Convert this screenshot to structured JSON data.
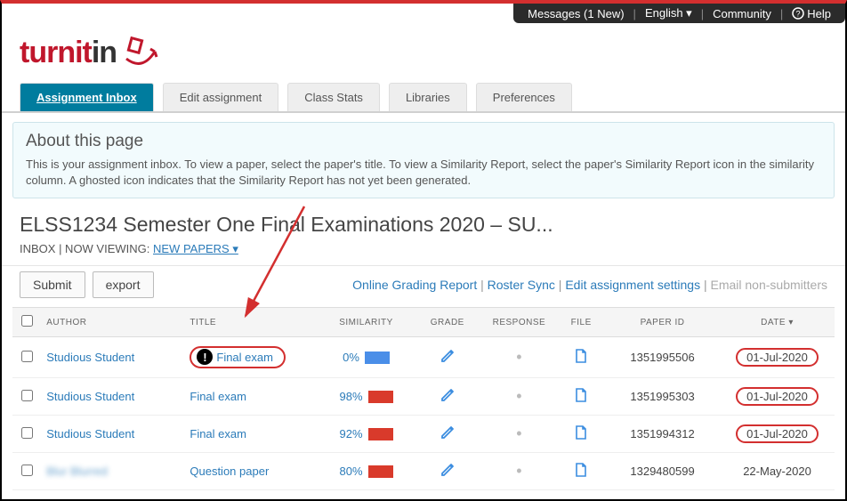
{
  "top": {
    "messages": "Messages (1 New)",
    "language": "English ▾",
    "community": "Community",
    "help": "Help"
  },
  "logo": {
    "part1": "turnit",
    "part2": "in"
  },
  "tabs": [
    {
      "label": "Assignment Inbox",
      "active": true
    },
    {
      "label": "Edit assignment",
      "active": false
    },
    {
      "label": "Class Stats",
      "active": false
    },
    {
      "label": "Libraries",
      "active": false
    },
    {
      "label": "Preferences",
      "active": false
    }
  ],
  "info": {
    "title": "About this page",
    "body": "This is your assignment inbox. To view a paper, select the paper's title. To view a Similarity Report, select the paper's Similarity Report icon in the similarity column. A ghosted icon indicates that the Similarity Report has not yet been generated."
  },
  "heading": "ELSS1234 Semester One Final Examinations 2020 – SU...",
  "viewing_prefix": "INBOX | NOW VIEWING: ",
  "viewing_link": "NEW PAPERS ▾",
  "buttons": {
    "submit": "Submit",
    "export": "export"
  },
  "links": {
    "ogr": "Online Grading Report",
    "roster": "Roster Sync",
    "edit": "Edit assignment settings",
    "email": "Email non-submitters"
  },
  "cols": {
    "author": "AUTHOR",
    "title": "TITLE",
    "similarity": "SIMILARITY",
    "grade": "GRADE",
    "response": "RESPONSE",
    "file": "FILE",
    "paperid": "PAPER ID",
    "date": "DATE"
  },
  "rows": [
    {
      "author": "Studious Student",
      "title": "Final exam",
      "alert": true,
      "circleTitle": true,
      "sim": "0%",
      "simcolor": "blue",
      "paperid": "1351995506",
      "date": "01-Jul-2020",
      "circleDate": true
    },
    {
      "author": "Studious Student",
      "title": "Final exam",
      "alert": false,
      "circleTitle": false,
      "sim": "98%",
      "simcolor": "red",
      "paperid": "1351995303",
      "date": "01-Jul-2020",
      "circleDate": true
    },
    {
      "author": "Studious Student",
      "title": "Final exam",
      "alert": false,
      "circleTitle": false,
      "sim": "92%",
      "simcolor": "red",
      "paperid": "1351994312",
      "date": "01-Jul-2020",
      "circleDate": true
    },
    {
      "author": "Blur Blurred",
      "title": "Question paper",
      "alert": false,
      "circleTitle": false,
      "sim": "80%",
      "simcolor": "red",
      "paperid": "1329480599",
      "date": "22-May-2020",
      "circleDate": false,
      "blurAuthor": true
    }
  ],
  "sort_indicator": "▾"
}
